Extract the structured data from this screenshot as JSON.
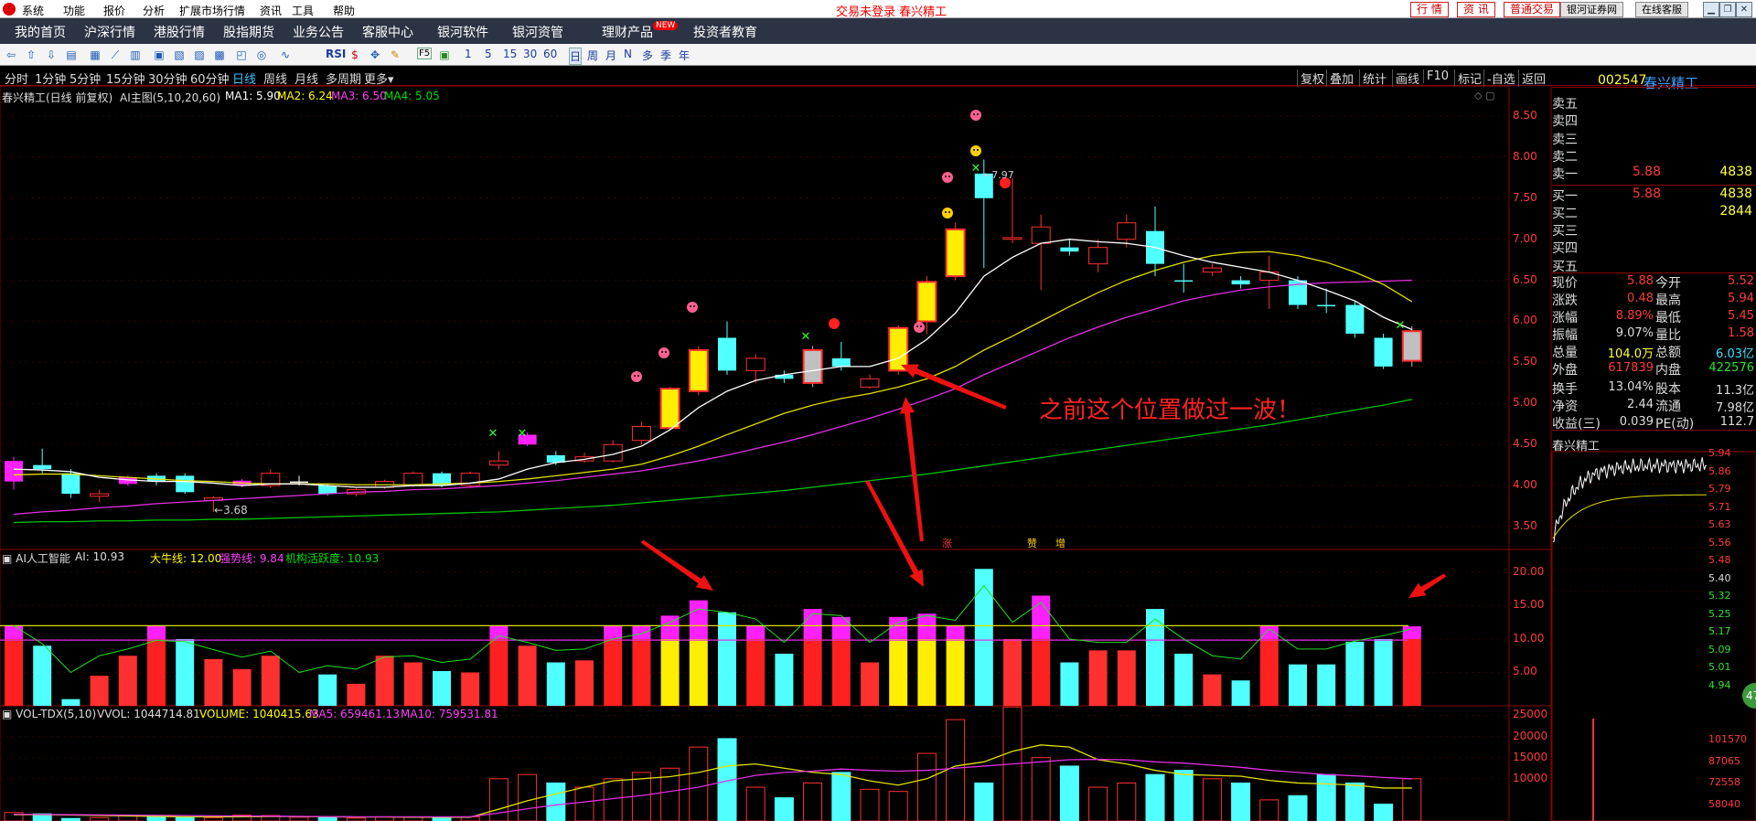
{
  "window": {
    "logo_icon": "app-logo-icon",
    "system_menu": [
      "系统",
      "功能",
      "报价",
      "分析",
      "扩展市场行情",
      "资讯",
      "工具",
      "帮助"
    ],
    "title_center": "交易未登录  春兴精工",
    "right_buttons": {
      "quote": "行 情",
      "info": "资 讯",
      "trade": "普通交易",
      "broker": "银河证券网",
      "service": "在线客服"
    }
  },
  "nav_menu": [
    "我的首页",
    "沪深行情",
    "港股行情",
    "股指期货",
    "业务公告",
    "客服中心",
    "银河软件",
    "银河资管",
    "理财产品",
    "投资者教育"
  ],
  "nav_new_badge": "NEW",
  "toolbar": {
    "indicator_buttons": [
      "RSI",
      "F5"
    ],
    "days": [
      "1",
      "5",
      "15",
      "30",
      "60"
    ],
    "periods": [
      "日",
      "周",
      "月",
      "N",
      "多",
      "季",
      "年"
    ]
  },
  "period_bar": {
    "items": [
      "分时",
      "1分钟",
      "5分钟",
      "15分钟",
      "30分钟",
      "60分钟",
      "日线",
      "周线",
      "月线",
      "多周期",
      "更多"
    ],
    "active": "日线",
    "right_tools": [
      "复权",
      "叠加",
      "统计",
      "画线",
      "F10",
      "标记",
      "-自选",
      "返回"
    ]
  },
  "stock": {
    "code": "002547",
    "name": "春兴精工"
  },
  "main_chart": {
    "header_title": "春兴精工(日线 前复权)",
    "header_indicator": "AI主图(5,10,20,60)",
    "ma1": "MA1: 5.90",
    "ma2": "MA2: 6.24",
    "ma3": "MA3: 6.50",
    "ma4": "MA4: 5.05",
    "low_label": "3.68",
    "high_label": "7.97",
    "annotation": "之前这个位置做过一波！",
    "bottom_marks": [
      "涨",
      "赞",
      "增"
    ],
    "y_ticks": [
      "8.50",
      "8.00",
      "7.50",
      "7.00",
      "6.50",
      "6.00",
      "5.50",
      "5.00",
      "4.50",
      "4.00",
      "3.50"
    ]
  },
  "ai_chart": {
    "title": "AI人工智能",
    "ai_value": "AI: 10.93",
    "bull_line": "大牛线: 12.00",
    "strong_line": "强势线: 9.84",
    "activity": "机构活跃度: 10.93",
    "y_ticks": [
      "20.00",
      "15.00",
      "10.00",
      "5.00"
    ]
  },
  "vol_chart": {
    "title": "VOL-TDX(5,10)",
    "vvol": "VVOL: 1044714.81",
    "volume": "VOLUME: 1040415.63",
    "ma5": "MA5: 659461.13",
    "ma10": "MA10: 759531.81",
    "y_ticks": [
      "25000",
      "20000",
      "15000",
      "10000"
    ]
  },
  "order_book": {
    "sell": [
      {
        "label": "卖五",
        "price": "",
        "vol": ""
      },
      {
        "label": "卖四",
        "price": "",
        "vol": ""
      },
      {
        "label": "卖三",
        "price": "",
        "vol": ""
      },
      {
        "label": "卖二",
        "price": "",
        "vol": ""
      },
      {
        "label": "卖一",
        "price": "5.88",
        "vol": "4838"
      }
    ],
    "buy": [
      {
        "label": "买一",
        "price": "5.88",
        "vol": "4838"
      },
      {
        "label": "买二",
        "price": "",
        "vol": "2844"
      },
      {
        "label": "买三",
        "price": "",
        "vol": ""
      },
      {
        "label": "买四",
        "price": "",
        "vol": ""
      },
      {
        "label": "买五",
        "price": "",
        "vol": ""
      }
    ]
  },
  "stats": [
    [
      "现价",
      "5.88",
      "今开",
      "5.52"
    ],
    [
      "涨跌",
      "0.48",
      "最高",
      "5.94"
    ],
    [
      "涨幅",
      "8.89%",
      "最低",
      "5.45"
    ],
    [
      "振幅",
      "9.07%",
      "量比",
      "1.58"
    ],
    [
      "总量",
      "104.0万",
      "总额",
      "6.03亿"
    ],
    [
      "外盘",
      "617839",
      "内盘",
      "422576"
    ]
  ],
  "stats2": [
    [
      "换手",
      "13.04%",
      "股本",
      "11.3亿"
    ],
    [
      "净资",
      "2.44",
      "流通",
      "7.98亿"
    ],
    [
      "收益(三)",
      "0.039",
      "PE(动)",
      "112.7"
    ]
  ],
  "mini": {
    "title": "春兴精工",
    "price_ticks": [
      "5.94",
      "5.86",
      "5.79",
      "5.71",
      "5.63",
      "5.56",
      "5.48",
      "5.40",
      "5.32",
      "5.25",
      "5.17",
      "5.09",
      "5.01",
      "4.94"
    ],
    "vol_ticks": [
      "101570",
      "87065",
      "72558",
      "58040"
    ],
    "badge": "47"
  },
  "chart_data": {
    "type": "candlestick",
    "title": "春兴精工(日线 前复权)",
    "ylim": [
      3.3,
      8.8
    ],
    "candles": [
      {
        "o": 4.05,
        "c": 4.3,
        "h": 4.35,
        "l": 3.95,
        "kind": "mag"
      },
      {
        "o": 4.2,
        "c": 4.25,
        "h": 4.45,
        "l": 4.15,
        "kind": "cyan"
      },
      {
        "o": 4.15,
        "c": 3.9,
        "h": 4.2,
        "l": 3.85,
        "kind": "cyan"
      },
      {
        "o": 3.9,
        "c": 3.87,
        "h": 3.95,
        "l": 3.8,
        "kind": "red"
      },
      {
        "o": 4.02,
        "c": 4.1,
        "h": 4.12,
        "l": 4.0,
        "kind": "mag"
      },
      {
        "o": 4.12,
        "c": 4.05,
        "h": 4.15,
        "l": 4.0,
        "kind": "cyan"
      },
      {
        "o": 4.12,
        "c": 3.92,
        "h": 4.15,
        "l": 3.9,
        "kind": "cyan"
      },
      {
        "o": 3.82,
        "c": 3.85,
        "h": 3.87,
        "l": 3.68,
        "kind": "red"
      },
      {
        "o": 4.0,
        "c": 4.06,
        "h": 4.08,
        "l": 3.98,
        "kind": "mag"
      },
      {
        "o": 4.0,
        "c": 4.15,
        "h": 4.2,
        "l": 3.97,
        "kind": "red"
      },
      {
        "o": 4.05,
        "c": 4.05,
        "h": 4.12,
        "l": 4.0,
        "kind": "white"
      },
      {
        "o": 4.0,
        "c": 3.9,
        "h": 4.02,
        "l": 3.88,
        "kind": "cyan"
      },
      {
        "o": 3.9,
        "c": 3.95,
        "h": 3.97,
        "l": 3.87,
        "kind": "red"
      },
      {
        "o": 3.98,
        "c": 4.05,
        "h": 4.07,
        "l": 3.96,
        "kind": "red"
      },
      {
        "o": 4.0,
        "c": 4.15,
        "h": 4.17,
        "l": 3.98,
        "kind": "red"
      },
      {
        "o": 4.15,
        "c": 4.0,
        "h": 4.17,
        "l": 3.98,
        "kind": "cyan"
      },
      {
        "o": 4.0,
        "c": 4.15,
        "h": 4.17,
        "l": 3.98,
        "kind": "red"
      },
      {
        "o": 4.25,
        "c": 4.3,
        "h": 4.42,
        "l": 4.2,
        "kind": "red"
      },
      {
        "o": 4.5,
        "c": 4.62,
        "h": 4.65,
        "l": 4.48,
        "kind": "mag"
      },
      {
        "o": 4.37,
        "c": 4.28,
        "h": 4.42,
        "l": 4.25,
        "kind": "cyan"
      },
      {
        "o": 4.3,
        "c": 4.35,
        "h": 4.4,
        "l": 4.28,
        "kind": "red"
      },
      {
        "o": 4.3,
        "c": 4.5,
        "h": 4.55,
        "l": 4.28,
        "kind": "red"
      },
      {
        "o": 4.55,
        "c": 4.72,
        "h": 4.78,
        "l": 4.5,
        "kind": "red"
      },
      {
        "o": 4.7,
        "c": 5.18,
        "h": 5.2,
        "l": 4.68,
        "kind": "yellow"
      },
      {
        "o": 5.15,
        "c": 5.65,
        "h": 5.7,
        "l": 5.1,
        "kind": "yellow"
      },
      {
        "o": 5.8,
        "c": 5.4,
        "h": 6.0,
        "l": 5.35,
        "kind": "cyan"
      },
      {
        "o": 5.4,
        "c": 5.55,
        "h": 5.6,
        "l": 5.25,
        "kind": "red"
      },
      {
        "o": 5.35,
        "c": 5.3,
        "h": 5.4,
        "l": 5.25,
        "kind": "cyan"
      },
      {
        "o": 5.25,
        "c": 5.65,
        "h": 5.7,
        "l": 5.2,
        "kind": "gray"
      },
      {
        "o": 5.55,
        "c": 5.45,
        "h": 5.75,
        "l": 5.4,
        "kind": "cyan"
      },
      {
        "o": 5.2,
        "c": 5.3,
        "h": 5.35,
        "l": 5.18,
        "kind": "red"
      },
      {
        "o": 5.4,
        "c": 5.92,
        "h": 5.95,
        "l": 5.35,
        "kind": "yellow"
      },
      {
        "o": 6.0,
        "c": 6.48,
        "h": 6.55,
        "l": 5.85,
        "kind": "yellow"
      },
      {
        "o": 6.55,
        "c": 7.12,
        "h": 7.2,
        "l": 6.5,
        "kind": "yellow"
      },
      {
        "o": 7.5,
        "c": 7.8,
        "h": 7.97,
        "l": 6.65,
        "kind": "cyan"
      },
      {
        "o": 7.02,
        "c": 7.0,
        "h": 7.75,
        "l": 6.95,
        "kind": "red"
      },
      {
        "o": 6.95,
        "c": 7.15,
        "h": 7.3,
        "l": 6.38,
        "kind": "red"
      },
      {
        "o": 6.9,
        "c": 6.85,
        "h": 7.0,
        "l": 6.8,
        "kind": "cyan"
      },
      {
        "o": 6.7,
        "c": 6.9,
        "h": 7.0,
        "l": 6.6,
        "kind": "red"
      },
      {
        "o": 7.0,
        "c": 7.2,
        "h": 7.3,
        "l": 6.9,
        "kind": "red"
      },
      {
        "o": 7.1,
        "c": 6.7,
        "h": 7.4,
        "l": 6.55,
        "kind": "cyan"
      },
      {
        "o": 6.5,
        "c": 6.5,
        "h": 6.7,
        "l": 6.35,
        "kind": "cyan"
      },
      {
        "o": 6.6,
        "c": 6.65,
        "h": 6.7,
        "l": 6.55,
        "kind": "red"
      },
      {
        "o": 6.5,
        "c": 6.45,
        "h": 6.55,
        "l": 6.4,
        "kind": "cyan"
      },
      {
        "o": 6.5,
        "c": 6.6,
        "h": 6.8,
        "l": 6.15,
        "kind": "red"
      },
      {
        "o": 6.5,
        "c": 6.2,
        "h": 6.55,
        "l": 6.15,
        "kind": "cyan"
      },
      {
        "o": 6.2,
        "c": 6.2,
        "h": 6.4,
        "l": 6.1,
        "kind": "cyan"
      },
      {
        "o": 6.2,
        "c": 5.85,
        "h": 6.25,
        "l": 5.8,
        "kind": "cyan"
      },
      {
        "o": 5.8,
        "c": 5.45,
        "h": 5.85,
        "l": 5.42,
        "kind": "cyan"
      },
      {
        "o": 5.52,
        "c": 5.88,
        "h": 5.94,
        "l": 5.45,
        "kind": "gray"
      }
    ],
    "ma_white": [
      4.2,
      4.19,
      4.17,
      4.1,
      4.07,
      4.05,
      4.05,
      4.03,
      4.0,
      4.02,
      4.02,
      4.0,
      3.98,
      3.98,
      4.0,
      4.0,
      4.03,
      4.08,
      4.2,
      4.28,
      4.32,
      4.38,
      4.48,
      4.68,
      4.95,
      5.15,
      5.28,
      5.35,
      5.4,
      5.45,
      5.45,
      5.55,
      5.78,
      6.1,
      6.55,
      6.78,
      6.95,
      7.0,
      6.97,
      6.95,
      6.9,
      6.8,
      6.72,
      6.66,
      6.6,
      6.5,
      6.38,
      6.25,
      6.05,
      5.9
    ],
    "ma_yellow": [
      4.13,
      4.14,
      4.14,
      4.12,
      4.1,
      4.08,
      4.06,
      4.05,
      4.03,
      4.02,
      4.02,
      4.02,
      4.01,
      4.01,
      4.01,
      4.02,
      4.03,
      4.05,
      4.08,
      4.12,
      4.16,
      4.2,
      4.26,
      4.36,
      4.48,
      4.62,
      4.75,
      4.88,
      4.98,
      5.06,
      5.12,
      5.2,
      5.3,
      5.45,
      5.65,
      5.82,
      6.0,
      6.18,
      6.35,
      6.5,
      6.62,
      6.72,
      6.8,
      6.84,
      6.85,
      6.8,
      6.72,
      6.6,
      6.45,
      6.24
    ],
    "ma_magenta": [
      3.65,
      3.68,
      3.7,
      3.73,
      3.75,
      3.78,
      3.8,
      3.82,
      3.84,
      3.86,
      3.88,
      3.9,
      3.92,
      3.93,
      3.95,
      3.96,
      3.98,
      4.0,
      4.03,
      4.06,
      4.1,
      4.14,
      4.18,
      4.24,
      4.3,
      4.37,
      4.45,
      4.53,
      4.62,
      4.72,
      4.82,
      4.93,
      5.05,
      5.18,
      5.35,
      5.5,
      5.65,
      5.8,
      5.93,
      6.05,
      6.15,
      6.25,
      6.32,
      6.38,
      6.42,
      6.45,
      6.47,
      6.48,
      6.49,
      6.5
    ],
    "ma_green": [
      3.55,
      3.56,
      3.56,
      3.57,
      3.57,
      3.58,
      3.58,
      3.59,
      3.59,
      3.6,
      3.61,
      3.62,
      3.63,
      3.64,
      3.65,
      3.66,
      3.67,
      3.68,
      3.7,
      3.72,
      3.74,
      3.76,
      3.79,
      3.82,
      3.85,
      3.88,
      3.91,
      3.94,
      3.98,
      4.02,
      4.06,
      4.1,
      4.14,
      4.19,
      4.24,
      4.29,
      4.34,
      4.39,
      4.44,
      4.49,
      4.54,
      4.59,
      4.64,
      4.69,
      4.74,
      4.8,
      4.86,
      4.92,
      4.98,
      5.05
    ],
    "ai_bars": [
      12,
      9,
      1,
      4.5,
      7.5,
      12,
      10,
      7,
      5.5,
      7.5,
      0,
      4.7,
      3.3,
      7.5,
      6.5,
      5.2,
      5,
      12,
      9,
      6.5,
      6.8,
      12,
      12,
      13.5,
      15.8,
      14,
      12,
      7.8,
      14.5,
      13.3,
      6.5,
      13.3,
      13.8,
      12,
      20.5,
      10,
      16.5,
      6.5,
      8.3,
      8.3,
      14.5,
      7.8,
      4.7,
      3.8,
      12,
      6.2,
      6.2,
      9.6,
      10,
      11.9
    ],
    "ai_kind": [
      "mag",
      "cyan",
      "cyan",
      "red",
      "red",
      "mag",
      "cyan",
      "red",
      "red",
      "red",
      "cyan",
      "cyan",
      "red",
      "red",
      "red",
      "cyan",
      "red",
      "mag",
      "red",
      "cyan",
      "red",
      "mag",
      "mag",
      "yellow",
      "yellow",
      "cyan",
      "mag",
      "cyan",
      "mag",
      "mag",
      "red",
      "yellow",
      "yellow",
      "yellow",
      "cyan",
      "red",
      "mag",
      "cyan",
      "red",
      "red",
      "cyan",
      "cyan",
      "red",
      "cyan",
      "mag",
      "cyan",
      "cyan",
      "cyan",
      "cyan",
      "mag"
    ],
    "ai_line": [
      12,
      9.3,
      5,
      7.5,
      8.5,
      9.8,
      9.6,
      8.4,
      7.3,
      8.2,
      5,
      6,
      5.5,
      7.3,
      7.5,
      6.5,
      7,
      10.5,
      9.5,
      8.3,
      8.5,
      10,
      10.8,
      12.5,
      14.5,
      14,
      13,
      9.5,
      13.8,
      13.5,
      9.5,
      12.5,
      13.5,
      12.8,
      18,
      12.5,
      15.5,
      10,
      9.5,
      9.5,
      13,
      10,
      7.5,
      7,
      11.5,
      8.5,
      8.5,
      9.7,
      10.5,
      11.5
    ],
    "vol": [
      2000,
      1700,
      600,
      800,
      1300,
      1200,
      900,
      800,
      1400,
      1300,
      900,
      800,
      700,
      1000,
      900,
      800,
      1000,
      10000,
      11000,
      9000,
      8000,
      10000,
      11500,
      12500,
      17500,
      19500,
      8000,
      5500,
      9000,
      11500,
      7500,
      7000,
      16000,
      24000,
      9000,
      27000,
      15000,
      13000,
      8000,
      9000,
      11000,
      12000,
      10000,
      9000,
      5000,
      6000,
      11000,
      9000,
      4000,
      10000
    ],
    "vol_ma5": [
      1500,
      1500,
      1400,
      1300,
      1200,
      1100,
      1000,
      1000,
      1000,
      1050,
      1050,
      1000,
      950,
      950,
      900,
      900,
      900,
      2800,
      4800,
      6400,
      8000,
      9500,
      10000,
      10500,
      11500,
      13000,
      13500,
      12500,
      11500,
      11000,
      9500,
      8500,
      10000,
      13000,
      14000,
      16500,
      18000,
      17500,
      14500,
      13500,
      12000,
      11000,
      10800,
      10600,
      9600,
      9000,
      8800,
      8500,
      7800,
      7800
    ],
    "vol_ma10": [
      1600,
      1550,
      1500,
      1450,
      1400,
      1350,
      1300,
      1250,
      1200,
      1150,
      1100,
      1050,
      1000,
      1000,
      1000,
      1000,
      1000,
      1900,
      2900,
      3800,
      4500,
      5300,
      6000,
      7000,
      8000,
      9500,
      10800,
      11500,
      11800,
      12300,
      12000,
      11800,
      12000,
      12500,
      13000,
      13500,
      14000,
      14500,
      14600,
      14500,
      14000,
      13700,
      13200,
      12700,
      12000,
      11500,
      11000,
      10700,
      10300,
      10000
    ]
  }
}
